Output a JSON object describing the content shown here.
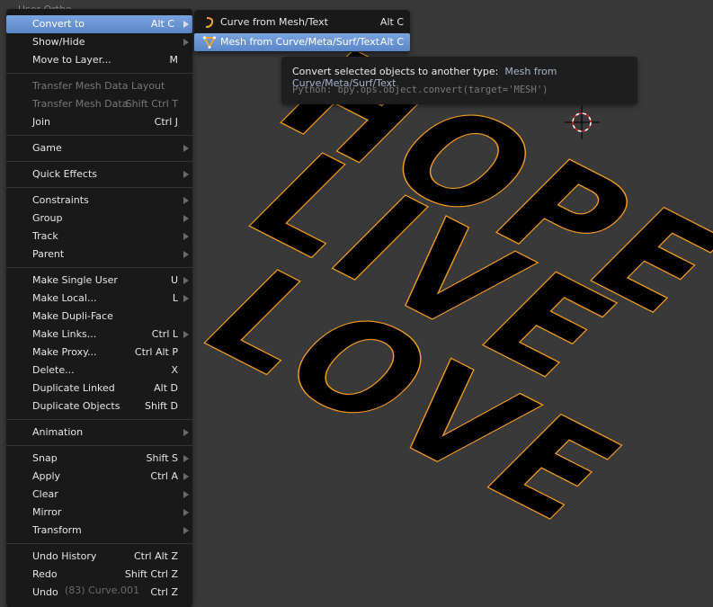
{
  "viewport": {
    "view_label": "User Ortho",
    "object_label": "(83) Curve.001",
    "words": [
      "HOPE",
      "LIVE",
      "LOVE"
    ],
    "outline_color": "#f29a1e"
  },
  "menu": {
    "items": [
      {
        "label": "Convert to",
        "shortcut": "Alt C",
        "submenu": true,
        "active": true
      },
      {
        "label": "Show/Hide",
        "shortcut": "",
        "submenu": true
      },
      {
        "label": "Move to Layer...",
        "shortcut": "M"
      },
      {
        "sep": true
      },
      {
        "label": "Transfer Mesh Data Layout",
        "shortcut": "",
        "disabled": true
      },
      {
        "label": "Transfer Mesh Data",
        "shortcut": "Shift Ctrl T",
        "disabled": true
      },
      {
        "label": "Join",
        "shortcut": "Ctrl J"
      },
      {
        "sep": true
      },
      {
        "label": "Game",
        "shortcut": "",
        "submenu": true
      },
      {
        "sep": true
      },
      {
        "label": "Quick Effects",
        "shortcut": "",
        "submenu": true
      },
      {
        "sep": true
      },
      {
        "label": "Constraints",
        "shortcut": "",
        "submenu": true
      },
      {
        "label": "Group",
        "shortcut": "",
        "submenu": true
      },
      {
        "label": "Track",
        "shortcut": "",
        "submenu": true
      },
      {
        "label": "Parent",
        "shortcut": "",
        "submenu": true
      },
      {
        "sep": true
      },
      {
        "label": "Make Single User",
        "shortcut": "U",
        "submenu": true
      },
      {
        "label": "Make Local...",
        "shortcut": "L",
        "submenu": true
      },
      {
        "label": "Make Dupli-Face",
        "shortcut": ""
      },
      {
        "label": "Make Links...",
        "shortcut": "Ctrl L",
        "submenu": true
      },
      {
        "label": "Make Proxy...",
        "shortcut": "Ctrl Alt P"
      },
      {
        "label": "Delete...",
        "shortcut": "X"
      },
      {
        "label": "Duplicate Linked",
        "shortcut": "Alt D"
      },
      {
        "label": "Duplicate Objects",
        "shortcut": "Shift D"
      },
      {
        "sep": true
      },
      {
        "label": "Animation",
        "shortcut": "",
        "submenu": true
      },
      {
        "sep": true
      },
      {
        "label": "Snap",
        "shortcut": "Shift S",
        "submenu": true
      },
      {
        "label": "Apply",
        "shortcut": "Ctrl A",
        "submenu": true
      },
      {
        "label": "Clear",
        "shortcut": "",
        "submenu": true
      },
      {
        "label": "Mirror",
        "shortcut": "",
        "submenu": true
      },
      {
        "label": "Transform",
        "shortcut": "",
        "submenu": true
      },
      {
        "sep": true
      },
      {
        "label": "Undo History",
        "shortcut": "Ctrl Alt Z"
      },
      {
        "label": "Redo",
        "shortcut": "Shift Ctrl Z"
      },
      {
        "label": "Undo",
        "shortcut": "Ctrl Z"
      }
    ]
  },
  "submenu": {
    "items": [
      {
        "label": "Curve from Mesh/Text",
        "shortcut": "Alt C",
        "icon": "curve-icon"
      },
      {
        "label": "Mesh from Curve/Meta/Surf/Text",
        "shortcut": "Alt C",
        "icon": "mesh-icon",
        "active": true
      }
    ]
  },
  "tooltip": {
    "description": "Convert selected objects to another type:",
    "value": "Mesh from Curve/Meta/Surf/Text",
    "python": "Python: bpy.ops.object.convert(target='MESH')"
  }
}
